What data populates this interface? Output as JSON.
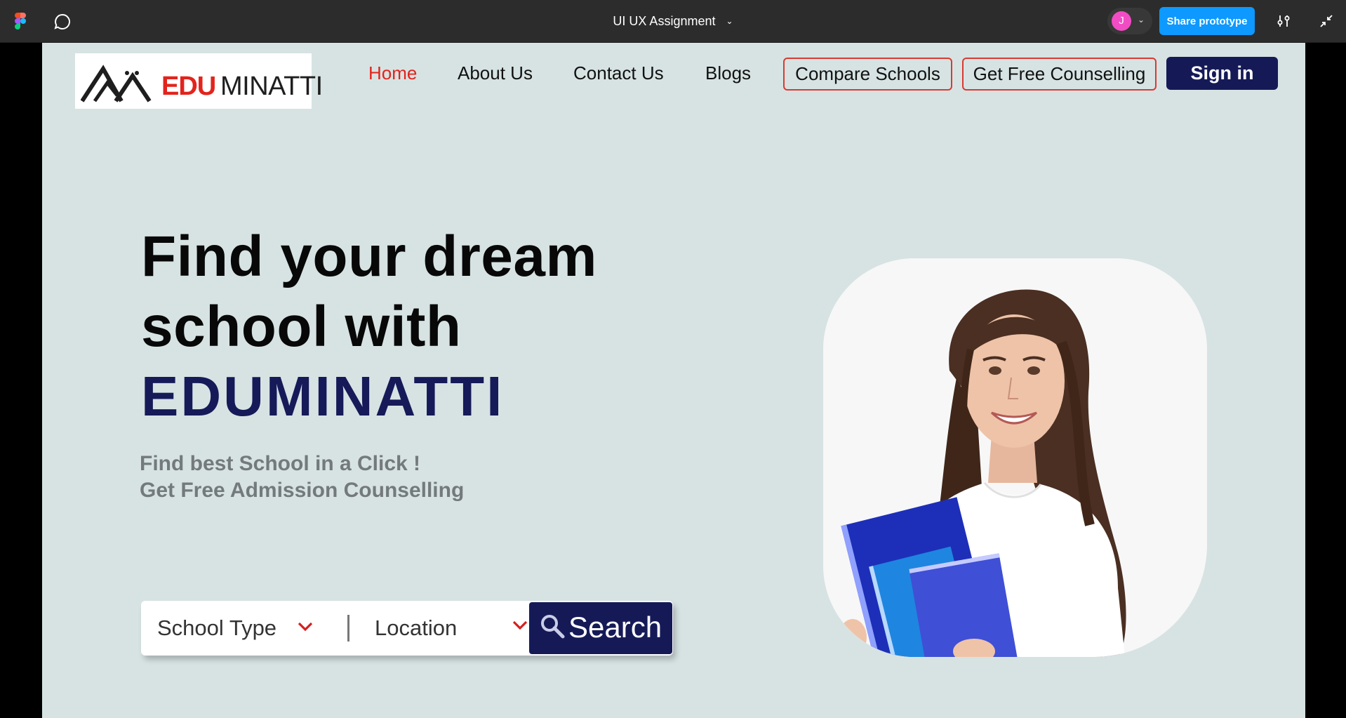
{
  "figma_bar": {
    "document_title": "UI UX Assignment",
    "avatar_initial": "J",
    "share_label": "Share prototype",
    "icons": [
      "figma-logo-icon",
      "comment-icon",
      "chevron-down-icon",
      "settings-sliders-icon",
      "collapse-icon"
    ]
  },
  "site": {
    "logo": {
      "part1": "EDU",
      "part2": "MINATTI"
    },
    "nav": {
      "home": "Home",
      "about": "About Us",
      "contact": "Contact Us",
      "blogs": "Blogs",
      "compare": "Compare Schools",
      "counselling": "Get Free Counselling",
      "signin": "Sign in"
    },
    "hero": {
      "line1": "Find your dream",
      "line2": "school with",
      "brand": "EDUMINATTI",
      "sub1": "Find best School in a Click !",
      "sub2": "Get Free Admission Counselling"
    },
    "search": {
      "school_type": "School Type",
      "location": "Location",
      "button": "Search"
    }
  },
  "colors": {
    "accent_red": "#e3231c",
    "navy": "#151a57",
    "page_bg": "#d7e3e3",
    "figma_blue": "#0d99ff"
  }
}
